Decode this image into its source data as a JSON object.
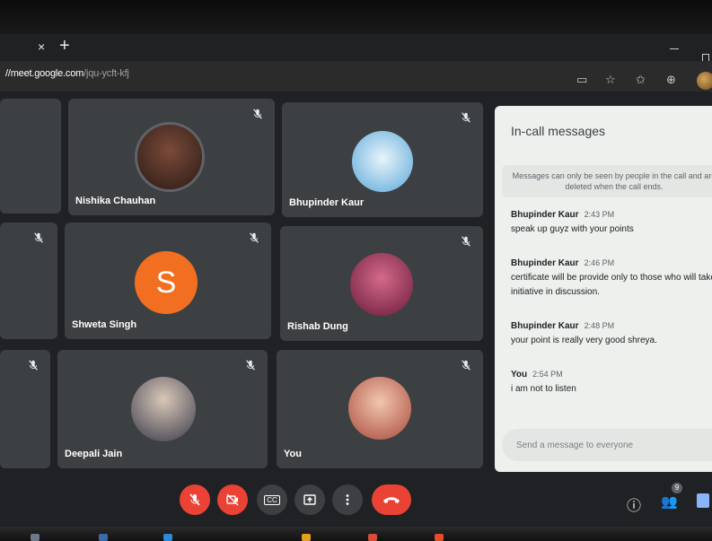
{
  "browser": {
    "tab_close": "×",
    "tab_new": "+",
    "url_host": "//meet.google.com",
    "url_path": "/jqu-ycft-kfj"
  },
  "participants": [
    {
      "name": "Nishika Chauhan",
      "avatar": "photo"
    },
    {
      "name": "Bhupinder Kaur",
      "avatar": "photo"
    },
    {
      "name": "Shweta Singh",
      "avatar": "letter",
      "letter": "S",
      "color": "#f26f21"
    },
    {
      "name": "Rishab Dung",
      "avatar": "photo"
    },
    {
      "name": "Deepali Jain",
      "avatar": "photo"
    },
    {
      "name": "You",
      "avatar": "photo"
    }
  ],
  "chat": {
    "title": "In-call messages",
    "notice": "Messages can only be seen by people in the call and are deleted when the call ends.",
    "messages": [
      {
        "sender": "Bhupinder Kaur",
        "time": "2:43 PM",
        "text": "speak up guyz with your points"
      },
      {
        "sender": "Bhupinder Kaur",
        "time": "2:46 PM",
        "text": "certificate will be provide only to those who will take",
        "text2": "initiative in discussion."
      },
      {
        "sender": "Bhupinder Kaur",
        "time": "2:48 PM",
        "text": "your point is really very good shreya."
      },
      {
        "sender": "You",
        "time": "2:54 PM",
        "text": "i am not to listen"
      }
    ],
    "input_placeholder": "Send a message to everyone"
  },
  "controls": {
    "captions_label": "CC",
    "badge_count": "9"
  },
  "colors": {
    "end_call": "#ea4335",
    "tile_bg": "#3c4043",
    "meet_bg": "#202124"
  }
}
